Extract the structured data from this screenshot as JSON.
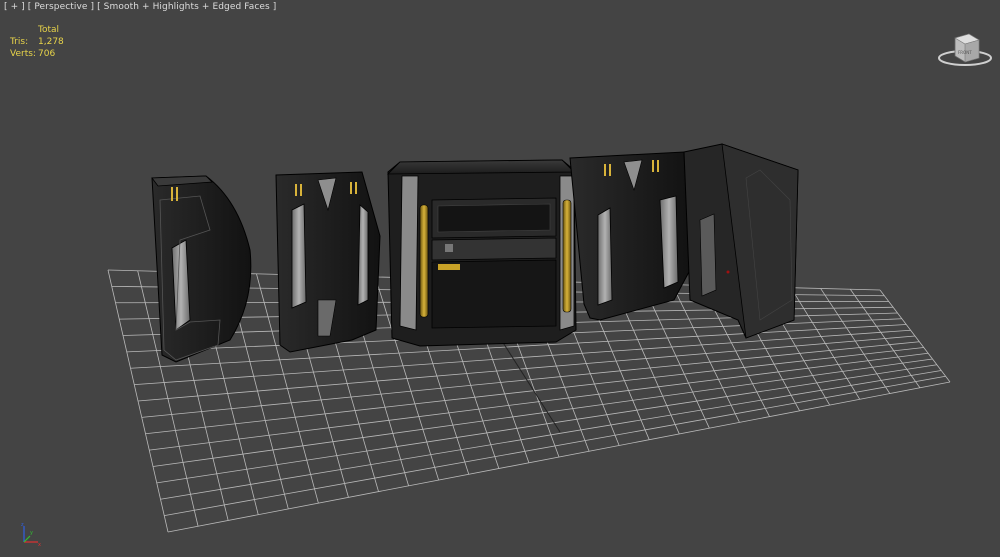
{
  "viewport": {
    "label_parts": [
      "[ + ]",
      "[ Perspective ]",
      "[ Smooth + Highlights + Edged Faces ]"
    ],
    "stats": {
      "header": "Total",
      "rows": [
        {
          "label": "Tris:",
          "value": "1,278"
        },
        {
          "label": "Verts:",
          "value": "706"
        }
      ]
    },
    "viewcube_face": "FRONT",
    "axis_labels": {
      "x": "x",
      "y": "y",
      "z": "z"
    }
  },
  "colors": {
    "background": "#444444",
    "grid": "#b9b9b9",
    "stats_text": "#e8d44a",
    "label_text": "#dcdcdc",
    "panel_dark": "#1a1a1a",
    "panel_light": "#9a9a9a",
    "accent_yellow": "#c9a227"
  }
}
